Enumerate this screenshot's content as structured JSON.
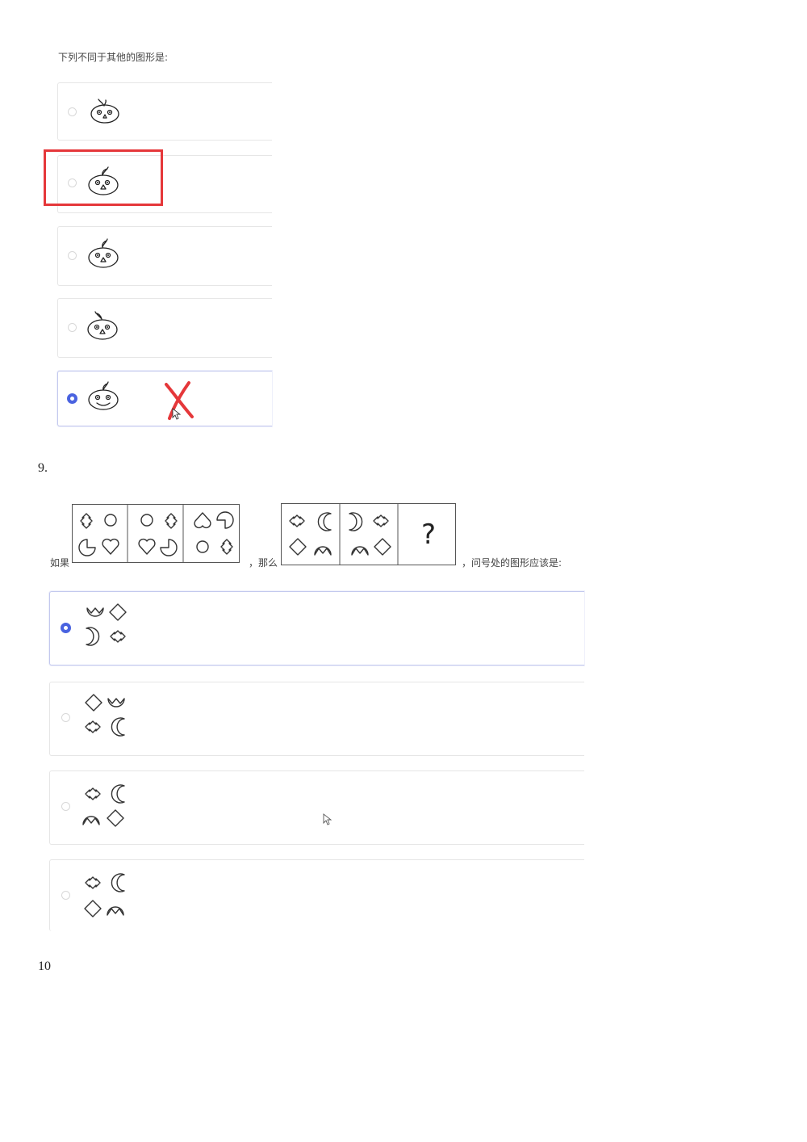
{
  "q8": {
    "prompt": "下列不同于其他的图形是:"
  },
  "q9": {
    "number": "9.",
    "prefix": "如果",
    "mid": "，那么",
    "suffix": "，问号处的图形应该是:",
    "question_mark": "?"
  },
  "q10": {
    "number": "10"
  },
  "icons": [
    "pumpkin-face-icon",
    "radio-icon",
    "red-x-mark-icon",
    "mouse-cursor-icon",
    "heart-icon",
    "diamond-icon",
    "crescent-icon",
    "circle-icon",
    "arrow-cross-icon",
    "pacman-icon"
  ],
  "colors": {
    "radio_selected": "#4a63e0",
    "annotation_red": "#e5373a"
  }
}
